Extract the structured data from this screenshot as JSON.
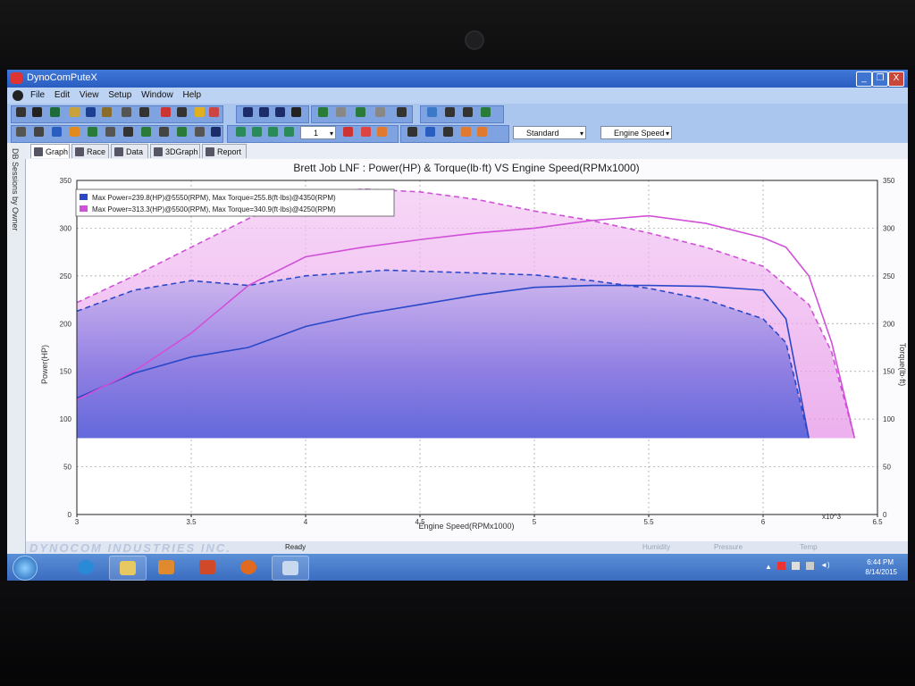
{
  "window": {
    "title": "DynoComPuteX",
    "minimize": "_",
    "maximize": "❐",
    "close": "X"
  },
  "menu": [
    "File",
    "Edit",
    "View",
    "Setup",
    "Window",
    "Help"
  ],
  "toolbar": {
    "page_value": "1",
    "mode_dropdown": "Standard",
    "axis_dropdown": "Engine Speed"
  },
  "side_panel": {
    "label": "DB Sessions by Owner"
  },
  "tabs": [
    "Graph",
    "Race",
    "Data",
    "3DGraph",
    "Report"
  ],
  "status": {
    "ready": "Ready",
    "footer_brand": "DYNOCOM INDUSTRIES INC.",
    "humidity": "Humidity",
    "pressure": "Pressure",
    "temp": "Temp"
  },
  "taskbar": {
    "time": "6:44 PM",
    "date": "8/14/2015",
    "apps": [
      "internet-explorer",
      "file-explorer",
      "media-player",
      "office",
      "firefox",
      "dynocom"
    ]
  },
  "colors": {
    "blue_series": "#2a48c8",
    "pink_series": "#d050d8",
    "titlebar": "#2a5dc0",
    "taskbar": "#3a6cc0"
  },
  "chart_data": {
    "type": "line",
    "title": "Brett Job LNF : Power(HP) & Torque(lb·ft) VS Engine Speed(RPMx1000)",
    "xlabel": "Engine Speed(RPMx1000)",
    "ylabel_left": "Power(HP)",
    "ylabel_right": "Torque(lb·ft)",
    "x_multiplier_label": "x10^3",
    "xlim": [
      3,
      6.5
    ],
    "ylim": [
      0,
      350
    ],
    "x_ticks": [
      "3",
      "3.5",
      "4",
      "4.5",
      "5",
      "5.5",
      "6",
      "6.5"
    ],
    "y_ticks": [
      "0",
      "50",
      "100",
      "150",
      "200",
      "250",
      "300",
      "350"
    ],
    "grid": true,
    "legend_position": "top-left",
    "legend": [
      "Max Power=239.8(HP)@5550(RPM), Max Torque=255.8(ft·lbs)@4350(RPM)",
      "Max Power=313.3(HP)@5500(RPM), Max Torque=340.9(ft·lbs)@4250(RPM)"
    ],
    "series": [
      {
        "style": "solid",
        "color": "#2a48c8",
        "x": [
          3.0,
          3.25,
          3.5,
          3.75,
          4.0,
          4.25,
          4.5,
          4.75,
          5.0,
          5.25,
          5.5,
          5.75,
          6.0,
          6.1,
          6.2
        ],
        "y": [
          122,
          148,
          165,
          175,
          197,
          210,
          220,
          230,
          238,
          240,
          240,
          239,
          235,
          205,
          80
        ]
      },
      {
        "style": "dashed",
        "color": "#2a48c8",
        "x": [
          3.0,
          3.25,
          3.5,
          3.75,
          4.0,
          4.35,
          4.75,
          5.0,
          5.25,
          5.5,
          5.75,
          6.0,
          6.1,
          6.2
        ],
        "y": [
          213,
          235,
          245,
          240,
          250,
          256,
          253,
          251,
          245,
          237,
          225,
          205,
          180,
          80
        ]
      },
      {
        "style": "solid",
        "color": "#d050d8",
        "x": [
          3.0,
          3.25,
          3.5,
          3.75,
          4.0,
          4.25,
          4.5,
          4.75,
          5.0,
          5.25,
          5.5,
          5.75,
          6.0,
          6.1,
          6.2,
          6.3,
          6.4
        ],
        "y": [
          120,
          150,
          190,
          240,
          270,
          280,
          288,
          295,
          300,
          308,
          313,
          305,
          290,
          280,
          250,
          180,
          80
        ]
      },
      {
        "style": "dashed",
        "color": "#d050d8",
        "x": [
          3.0,
          3.25,
          3.5,
          3.75,
          4.0,
          4.25,
          4.5,
          4.75,
          5.0,
          5.25,
          5.5,
          5.75,
          6.0,
          6.1,
          6.2,
          6.3,
          6.4
        ],
        "y": [
          222,
          250,
          280,
          310,
          335,
          341,
          338,
          330,
          318,
          308,
          295,
          280,
          260,
          240,
          220,
          170,
          80
        ]
      }
    ]
  }
}
